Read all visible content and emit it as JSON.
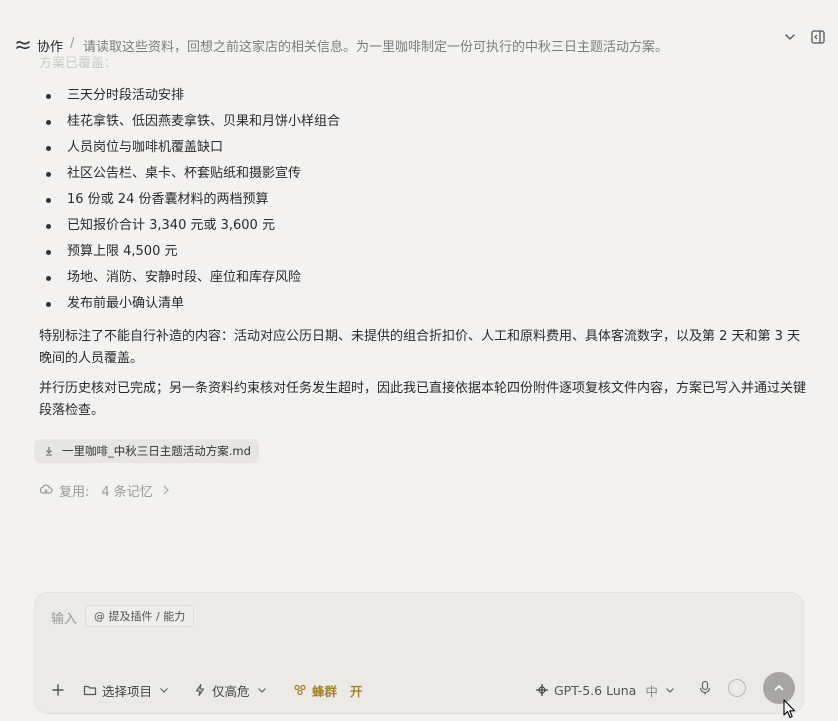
{
  "header": {
    "title": "协作",
    "separator": "/",
    "prompt": "请读取这些资料，回想之前这家店的相关信息。为一里咖啡制定一份可执行的中秋三日主题活动方案。"
  },
  "content": {
    "faded_line": "方案已覆盖：",
    "bullets": [
      "三天分时段活动安排",
      "桂花拿铁、低因燕麦拿铁、贝果和月饼小样组合",
      "人员岗位与咖啡机覆盖缺口",
      "社区公告栏、桌卡、杯套贴纸和摄影宣传",
      "16 份或 24 份香囊材料的两档预算",
      "已知报价合计 3,340 元或 3,600 元",
      "预算上限 4,500 元",
      "场地、消防、安静时段、座位和库存风险",
      "发布前最小确认清单"
    ],
    "paragraph1": "特别标注了不能自行补造的内容：活动对应公历日期、未提供的组合折扣价、人工和原料费用、具体客流数字，以及第 2 天和第 3 天晚间的人员覆盖。",
    "paragraph2": "并行历史核对已完成；另一条资料约束核对任务发生超时，因此我已直接依据本轮四份附件逐项复核文件内容，方案已写入并通过关键段落检查。",
    "file_name": "一里咖啡_中秋三日主题活动方案.md",
    "reuse_label": "复用:",
    "reuse_count": "4 条记忆"
  },
  "composer": {
    "input_label": "输入",
    "mention_chip": "@ 提及插件 / 能力",
    "project_label": "选择项目",
    "risk_label": "仅高危",
    "swarm_label": "蜂群",
    "swarm_state": "开",
    "model_label": "GPT-5.6 Luna",
    "model_effort": "中"
  },
  "colors": {
    "background": "#f3f2f0",
    "composer_bg": "#eceae7",
    "swarm_accent": "#a8812a",
    "send_button": "#a8a6a2"
  }
}
